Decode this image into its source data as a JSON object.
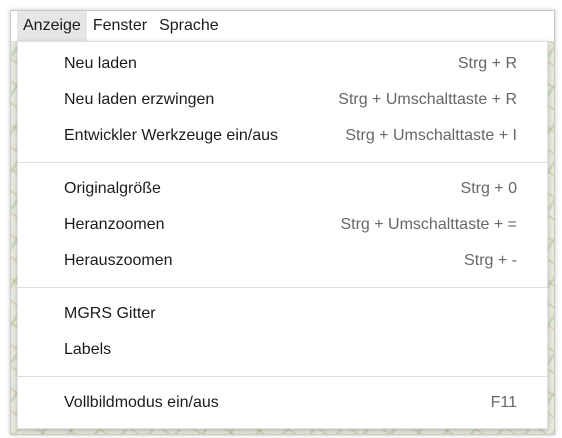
{
  "menubar": {
    "items": [
      {
        "label": "Anzeige"
      },
      {
        "label": "Fenster"
      },
      {
        "label": "Sprache"
      }
    ]
  },
  "menu": {
    "groups": [
      [
        {
          "label": "Neu laden",
          "shortcut": "Strg + R"
        },
        {
          "label": "Neu laden erzwingen",
          "shortcut": "Strg + Umschalttaste + R"
        },
        {
          "label": "Entwickler Werkzeuge ein/aus",
          "shortcut": "Strg + Umschalttaste + I"
        }
      ],
      [
        {
          "label": "Originalgröße",
          "shortcut": "Strg + 0"
        },
        {
          "label": "Heranzoomen",
          "shortcut": "Strg + Umschalttaste + ="
        },
        {
          "label": "Herauszoomen",
          "shortcut": "Strg + -"
        }
      ],
      [
        {
          "label": "MGRS Gitter",
          "shortcut": ""
        },
        {
          "label": "Labels",
          "shortcut": ""
        }
      ],
      [
        {
          "label": "Vollbildmodus ein/aus",
          "shortcut": "F11"
        }
      ]
    ]
  }
}
